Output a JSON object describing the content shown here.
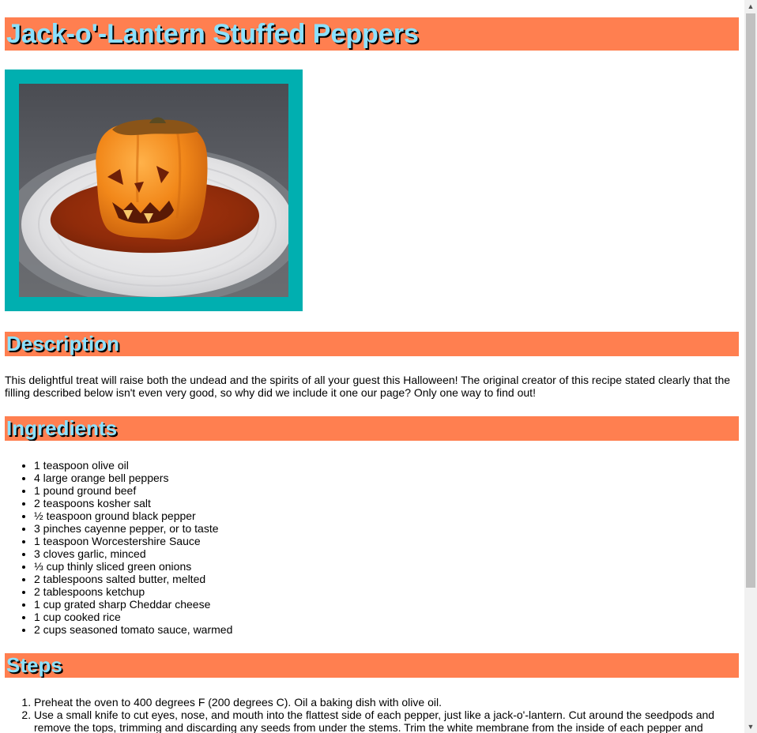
{
  "recipe": {
    "title": "Jack-o'-Lantern Stuffed Peppers",
    "image_alt": "Jack-o'-lantern stuffed pepper on a plate with tomato sauce",
    "description_heading": "Description",
    "description": "This delightful treat will raise both the undead and the spirits of all your guest this Halloween! The original creator of this recipe stated clearly that the filling described below isn't even very good, so why did we include it one our page? Only one way to find out!",
    "ingredients_heading": "Ingredients",
    "ingredients": [
      "1 teaspoon olive oil",
      "4 large orange bell peppers",
      "1 pound ground beef",
      "2 teaspoons kosher salt",
      "½ teaspoon ground black pepper",
      "3 pinches cayenne pepper, or to taste",
      "1 teaspoon Worcestershire Sauce",
      "3 cloves garlic, minced",
      "⅓ cup thinly sliced green onions",
      "2 tablespoons salted butter, melted",
      "2 tablespoons ketchup",
      "1 cup grated sharp Cheddar cheese",
      "1 cup cooked rice",
      "2 cups seasoned tomato sauce, warmed"
    ],
    "steps_heading": "Steps",
    "steps": [
      "Preheat the oven to 400 degrees F (200 degrees C). Oil a baking dish with olive oil.",
      "Use a small knife to cut eyes, nose, and mouth into the flattest side of each pepper, just like a jack-o'-lantern. Cut around the seedpods and remove the tops, trimming and discarding any seeds from under the stems. Trim the white membrane from the inside of each pepper and"
    ]
  },
  "colors": {
    "banner_background": "#ff7f50",
    "banner_text": "#8be1ff",
    "image_frame": "#00afb0"
  },
  "scrollbar": {
    "up_icon": "triangle-up",
    "down_icon": "triangle-down",
    "position_fraction": 0
  }
}
